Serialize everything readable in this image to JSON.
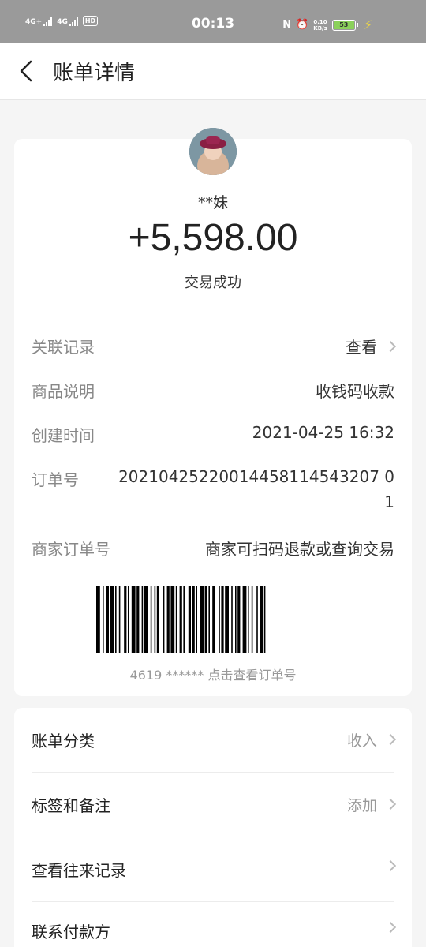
{
  "status_bar": {
    "net1": "4G+",
    "net2": "4G",
    "hd": "HD",
    "time": "00:13",
    "speed_value": "0.10",
    "speed_unit": "KB/s",
    "battery": "53"
  },
  "header": {
    "title": "账单详情"
  },
  "summary": {
    "name": "**妹",
    "amount": "+5,598.00",
    "status": "交易成功"
  },
  "details": [
    {
      "label": "关联记录",
      "value": "查看"
    },
    {
      "label": "商品说明",
      "value": "收钱码收款"
    },
    {
      "label": "创建时间",
      "value": "2021-04-25 16:32"
    },
    {
      "label": "订单号",
      "value": "20210425220014458114543207 01"
    },
    {
      "label": "商家订单号",
      "value": "商家可扫码退款或查询交易"
    }
  ],
  "barcode_caption": "4619 ****** 点击查看订单号",
  "actions": [
    {
      "label": "账单分类",
      "value": "收入"
    },
    {
      "label": "标签和备注",
      "value": "添加"
    },
    {
      "label": "查看往来记录",
      "value": ""
    },
    {
      "label": "联系付款方",
      "value": ""
    }
  ],
  "colors": {
    "status_bar_bg": "#9a9a9a",
    "battery_green": "#8bd15a",
    "page_bg": "#f5f5f5"
  }
}
